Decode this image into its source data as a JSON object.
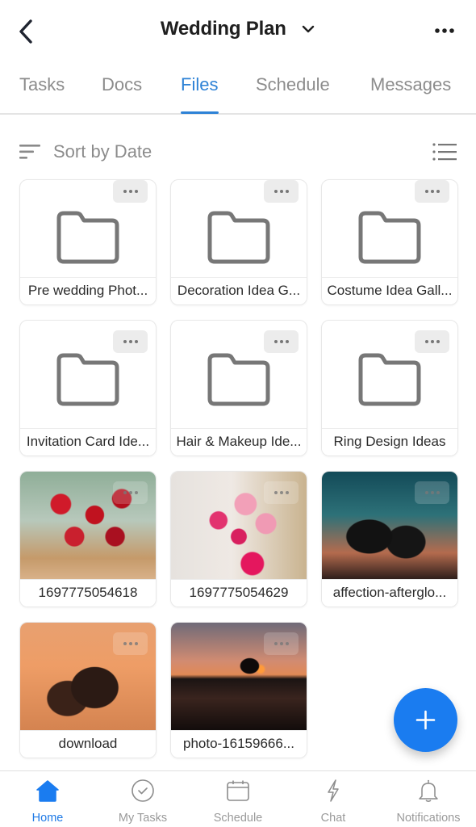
{
  "header": {
    "title": "Wedding Plan",
    "back_icon": "chevron-left-icon",
    "title_dropdown_icon": "chevron-down-icon",
    "more_icon": "more-horizontal-icon"
  },
  "tabs": [
    {
      "label": "Tasks",
      "active": false
    },
    {
      "label": "Docs",
      "active": false
    },
    {
      "label": "Files",
      "active": true
    },
    {
      "label": "Schedule",
      "active": false
    },
    {
      "label": "Messages",
      "active": false
    }
  ],
  "sortbar": {
    "label": "Sort by Date",
    "sort_icon": "sort-icon",
    "view_icon": "list-view-icon"
  },
  "files": [
    {
      "name": "Pre wedding Phot...",
      "type": "folder"
    },
    {
      "name": "Decoration Idea G...",
      "type": "folder"
    },
    {
      "name": "Costume Idea Gall...",
      "type": "folder"
    },
    {
      "name": "Invitation Card Ide...",
      "type": "folder"
    },
    {
      "name": "Hair & Makeup Ide...",
      "type": "folder"
    },
    {
      "name": "Ring Design Ideas",
      "type": "folder"
    },
    {
      "name": "1697775054618",
      "type": "image",
      "image": "red roses basket"
    },
    {
      "name": "1697775054629",
      "type": "image",
      "image": "pink flower bouquet"
    },
    {
      "name": "affection-afterglo...",
      "type": "image",
      "image": "couple silhouette at dusk"
    },
    {
      "name": "download",
      "type": "image",
      "image": "couple making heart at sunset"
    },
    {
      "name": "photo-16159666...",
      "type": "image",
      "image": "couple dancing on beach at sunset"
    }
  ],
  "fab": {
    "icon": "plus-icon"
  },
  "bottom_nav": [
    {
      "label": "Home",
      "icon": "home-icon",
      "active": true
    },
    {
      "label": "My Tasks",
      "icon": "check-circle-icon",
      "active": false
    },
    {
      "label": "Schedule",
      "icon": "calendar-icon",
      "active": false
    },
    {
      "label": "Chat",
      "icon": "lightning-icon",
      "active": false
    },
    {
      "label": "Notifications",
      "icon": "bell-icon",
      "active": false
    }
  ],
  "colors": {
    "accent": "#2e82d6",
    "fab": "#1a7cf0",
    "inactive_text": "#8c8c8c"
  }
}
